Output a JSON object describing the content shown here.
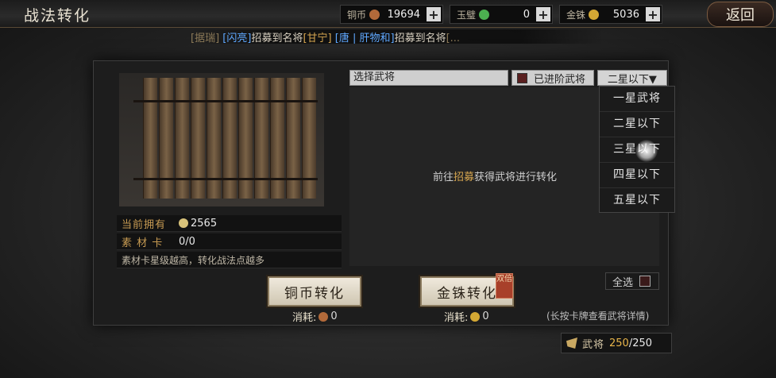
{
  "title": "战法转化",
  "back_label": "返回",
  "resources": [
    {
      "label": "铜币",
      "value": "19694",
      "color": "#b36a3a"
    },
    {
      "label": "玉璧",
      "value": "0",
      "color": "#4caf50"
    },
    {
      "label": "金铢",
      "value": "5036",
      "color": "#d4a834"
    }
  ],
  "ticker": {
    "seg1_dim": "[据瑞]",
    "seg1_blue": "[闪亮]",
    "seg1_text": "招募到名将",
    "seg1_gold": "[甘宁]",
    "seg2_blue": "[唐 | 肝物和]",
    "seg2_text": "招募到名将",
    "seg2_dim": "[..."
  },
  "left": {
    "owned_label": "当前拥有",
    "owned_value": "2565",
    "material_label": "素 材 卡",
    "material_value": "0/0",
    "note": "素材卡星级越高，转化战法点越多"
  },
  "header": {
    "select_general": "选择武将",
    "advanced_label": "已进阶武将",
    "star_filter": "二星以下▼"
  },
  "hint": {
    "pre": "前往",
    "highlight": "招募",
    "post": "获得武将进行转化"
  },
  "star_options": [
    "一星武将",
    "二星以下",
    "三星以下",
    "四星以下",
    "五星以下"
  ],
  "buttons": {
    "copper_convert": "铜币转化",
    "gold_convert": "金铢转化",
    "gold_tag": "双倍"
  },
  "costs": {
    "label": "消耗:",
    "copper_value": "0",
    "gold_value": "0"
  },
  "select_all": "全选",
  "detail_hint": "(长按卡牌查看武将详情)",
  "generals": {
    "label": "武将",
    "current": "250",
    "total": "/250"
  }
}
